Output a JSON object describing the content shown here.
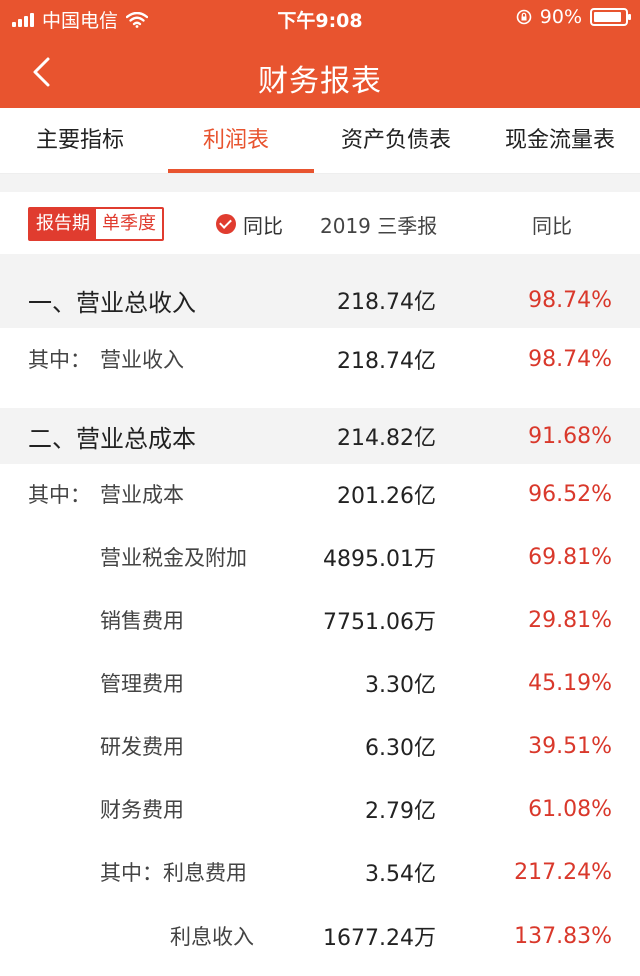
{
  "status": {
    "carrier": "中国电信",
    "time": "下午9:08",
    "battery": "90%",
    "battery_level": 0.9
  },
  "header": {
    "title": "财务报表",
    "back_icon": "chevron-left-icon"
  },
  "tabs": [
    {
      "label": "主要指标",
      "active": false
    },
    {
      "label": "利润表",
      "active": true
    },
    {
      "label": "资产负债表",
      "active": false
    },
    {
      "label": "现金流量表",
      "active": false
    }
  ],
  "filter": {
    "segment_on": "报告期",
    "segment_off": "单季度",
    "yoy_toggle": "同比",
    "period": "2019 三季报",
    "column_header": "同比"
  },
  "rows": [
    {
      "type": "section",
      "name": "一、营业总收入",
      "value": "218.74亿",
      "pct": "98.74%"
    },
    {
      "type": "sub",
      "prefix": "其中：",
      "name": "营业收入",
      "value": "218.74亿",
      "pct": "98.74%"
    },
    {
      "type": "section",
      "name": "二、营业总成本",
      "value": "214.82亿",
      "pct": "91.68%"
    },
    {
      "type": "sub",
      "prefix": "其中：",
      "name": "营业成本",
      "value": "201.26亿",
      "pct": "96.52%"
    },
    {
      "type": "sub",
      "name": "营业税金及附加",
      "value": "4895.01万",
      "pct": "69.81%"
    },
    {
      "type": "sub",
      "name": "销售费用",
      "value": "7751.06万",
      "pct": "29.81%"
    },
    {
      "type": "sub",
      "name": "管理费用",
      "value": "3.30亿",
      "pct": "45.19%"
    },
    {
      "type": "sub",
      "name": "研发费用",
      "value": "6.30亿",
      "pct": "39.51%"
    },
    {
      "type": "sub",
      "name": "财务费用",
      "value": "2.79亿",
      "pct": "61.08%"
    },
    {
      "type": "sub",
      "name": "其中：利息费用",
      "value": "3.54亿",
      "pct": "217.24%"
    },
    {
      "type": "sub",
      "name": "利息收入",
      "value": "1677.24万",
      "pct": "137.83%"
    }
  ],
  "colors": {
    "brand": "#e8542f",
    "accent_red": "#d9382b",
    "section_bg": "#f3f3f3"
  }
}
